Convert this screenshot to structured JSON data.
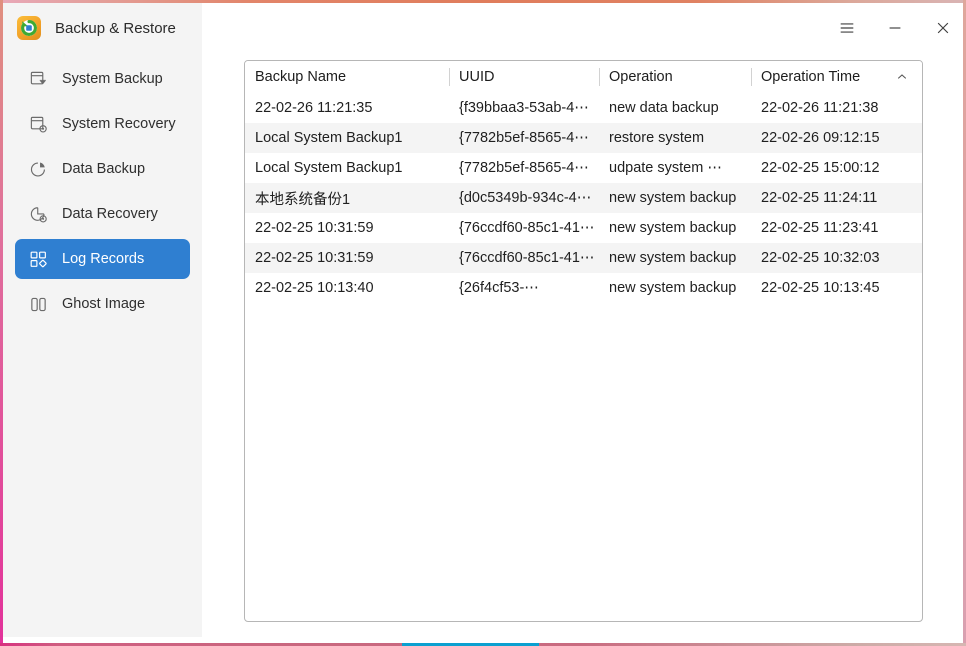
{
  "window": {
    "title": "Backup & Restore",
    "app_icon": "backup-restore-icon",
    "controls": [
      {
        "name": "menu-button",
        "glyph": "hamburger-icon",
        "label": "Menu"
      },
      {
        "name": "minimize-button",
        "glyph": "minimize-icon",
        "label": "Minimize"
      },
      {
        "name": "close-button",
        "glyph": "close-icon",
        "label": "Close"
      }
    ],
    "accent_color": "#2f7fd1",
    "border_bottom_accent_color": "#0aa0d0"
  },
  "sidebar": {
    "items": [
      {
        "label": "System Backup",
        "icon": "system-backup-icon",
        "selected": false
      },
      {
        "label": "System Recovery",
        "icon": "system-recovery-icon",
        "selected": false
      },
      {
        "label": "Data Backup",
        "icon": "data-backup-icon",
        "selected": false
      },
      {
        "label": "Data Recovery",
        "icon": "data-recovery-icon",
        "selected": false
      },
      {
        "label": "Log Records",
        "icon": "log-records-icon",
        "selected": true
      },
      {
        "label": "Ghost Image",
        "icon": "ghost-image-icon",
        "selected": false
      }
    ]
  },
  "table": {
    "sort_column": "Operation Time",
    "sort_direction": "ascending",
    "sort_icon": "chevron-up-icon",
    "columns": [
      {
        "label": "Backup Name"
      },
      {
        "label": "UUID"
      },
      {
        "label": "Operation"
      },
      {
        "label": "Operation Time"
      }
    ],
    "rows": [
      {
        "backup_name": "22-02-26 11:21:35",
        "uuid": "{f39bbaa3-53ab-4⋯",
        "operation": "new data backup",
        "operation_time": "22-02-26 11:21:38"
      },
      {
        "backup_name": "Local System Backup1",
        "uuid": "{7782b5ef-8565-4⋯",
        "operation": "restore system",
        "operation_time": "22-02-26 09:12:15"
      },
      {
        "backup_name": "Local System Backup1",
        "uuid": "{7782b5ef-8565-4⋯",
        "operation": "udpate system ⋯",
        "operation_time": "22-02-25 15:00:12"
      },
      {
        "backup_name": "本地系统备份1",
        "uuid": "{d0c5349b-934c-4⋯",
        "operation": "new system backup",
        "operation_time": "22-02-25 11:24:11"
      },
      {
        "backup_name": "22-02-25 10:31:59",
        "uuid": "{76ccdf60-85c1-41⋯",
        "operation": "new system backup",
        "operation_time": "22-02-25 11:23:41"
      },
      {
        "backup_name": "22-02-25 10:31:59",
        "uuid": "{76ccdf60-85c1-41⋯",
        "operation": "new system backup",
        "operation_time": "22-02-25 10:32:03"
      },
      {
        "backup_name": "22-02-25 10:13:40",
        "uuid": "{26f4cf53-⋯",
        "operation": "new system backup",
        "operation_time": "22-02-25 10:13:45"
      }
    ]
  }
}
